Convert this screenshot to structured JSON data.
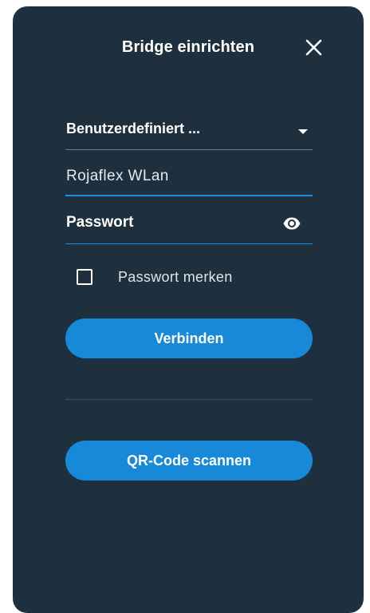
{
  "dialog": {
    "title": "Bridge einrichten",
    "close_icon": "close-icon"
  },
  "network_select": {
    "selected_value": "Benutzerdefiniert ...",
    "icon": "dropdown-arrow-icon"
  },
  "ssid_field": {
    "value": "Rojaflex WLan"
  },
  "password_field": {
    "placeholder": "Passwort",
    "value": "",
    "icon": "eye-icon"
  },
  "remember_password": {
    "label": "Passwort merken",
    "checked": false
  },
  "buttons": {
    "connect_label": "Verbinden",
    "qr_label": "QR-Code scannen"
  },
  "colors": {
    "background": "#1e303d",
    "accent": "#1889d9",
    "text": "#ffffff"
  }
}
